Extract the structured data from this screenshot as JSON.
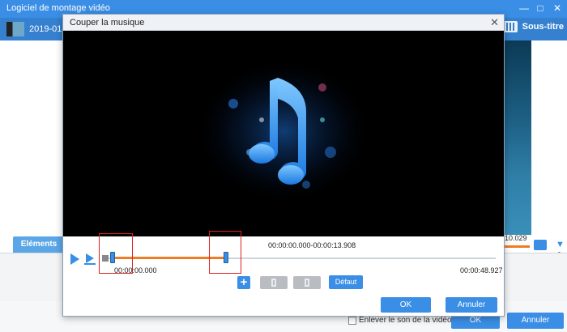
{
  "app": {
    "title": "Logiciel de montage vidéo",
    "clip_label": "2019-01",
    "subtitle_label": "Sous-titre",
    "elements_tab": "Eléments",
    "preview_time": "10.029",
    "remove_sound_label": "Enlever le son de la vidéo",
    "ok_label": "OK",
    "cancel_label": "Annuler"
  },
  "dialog": {
    "title": "Couper la musique",
    "time_range": "00:00:00.000-00:00:13.908",
    "start_time": "00:00:00.000",
    "end_time": "00:00:48.927",
    "default_label": "Défaut",
    "ok_label": "OK",
    "cancel_label": "Annuler",
    "add_label": "+"
  },
  "colors": {
    "accent": "#3a8ee6",
    "trim_fill": "#f07c22",
    "highlight": "#e02020"
  },
  "icons": [
    "music-note-icon",
    "play-icon",
    "play-segment-icon",
    "add-icon",
    "minimize-icon",
    "maximize-icon",
    "close-icon",
    "camera-icon",
    "volume-icon"
  ]
}
